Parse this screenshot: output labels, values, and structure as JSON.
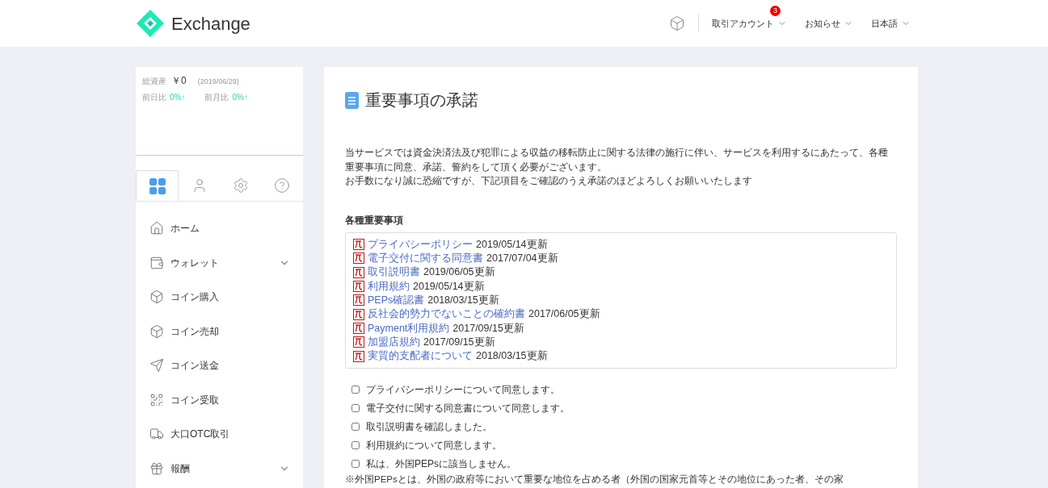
{
  "header": {
    "brand": "Exchange",
    "nav": [
      {
        "label": "取引アカウント",
        "badge": "3"
      },
      {
        "label": "お知らせ"
      },
      {
        "label": "日本語"
      }
    ]
  },
  "summary": {
    "total_label": "総資産",
    "total_value": "￥0",
    "date": "(2019/06/29)",
    "changes": [
      {
        "label": "前日比",
        "value": "0%↑"
      },
      {
        "label": "前月比",
        "value": "0%↑"
      }
    ]
  },
  "sidebar_tabs": [
    {
      "kind": "grid",
      "selected": true
    },
    {
      "kind": "user",
      "selected": false
    },
    {
      "kind": "settings",
      "selected": false
    },
    {
      "kind": "help",
      "selected": false
    }
  ],
  "sidebar": {
    "items": [
      {
        "kind": "home",
        "label": "ホーム",
        "expandable": false
      },
      {
        "kind": "wallet",
        "label": "ウォレット",
        "expandable": true
      },
      {
        "kind": "box",
        "label": "コイン購入",
        "expandable": false
      },
      {
        "kind": "box",
        "label": "コイン売却",
        "expandable": false
      },
      {
        "kind": "send",
        "label": "コイン送金",
        "expandable": false
      },
      {
        "kind": "qr",
        "label": "コイン受取",
        "expandable": false
      },
      {
        "kind": "truck",
        "label": "大口OTC取引",
        "expandable": false
      },
      {
        "kind": "gift",
        "label": "報酬",
        "expandable": true
      }
    ]
  },
  "page": {
    "title": "重要事項の承諾",
    "intro": [
      "当サービスでは資金決済法及び犯罪による収益の移転防止に関する法律の施行に伴い、サービスを利用するにあたって、各種重要事項に同意、承諾、誓約をして頂く必要がございます。",
      "お手数になり誠に恐縮ですが、下記項目をご確認のうえ承諾のほどよろしくお願いいたします"
    ],
    "documents_heading": "各種重要事項",
    "documents": [
      {
        "link": "プライバシーポリシー",
        "updated": "2019/05/14更新"
      },
      {
        "link": "電子交付に関する同意書",
        "updated": "2017/07/04更新"
      },
      {
        "link": "取引説明書",
        "updated": "2019/06/05更新"
      },
      {
        "link": "利用規約",
        "updated": "2019/05/14更新"
      },
      {
        "link": "PEPs確認書",
        "updated": "2018/03/15更新"
      },
      {
        "link": "反社会的勢力でないことの確約書",
        "updated": "2017/06/05更新"
      },
      {
        "link": "Payment利用規約",
        "updated": "2017/09/15更新"
      },
      {
        "link": "加盟店規約",
        "updated": "2017/09/15更新"
      },
      {
        "link": "実質的支配者について",
        "updated": "2018/03/15更新"
      }
    ],
    "agreements": [
      {
        "label": "プライバシーポリシーについて同意します。",
        "checked": false
      },
      {
        "label": "電子交付に関する同意書について同意します。",
        "checked": false
      },
      {
        "label": "取引説明書を確認しました。",
        "checked": false
      },
      {
        "label": "利用規約について同意します。",
        "checked": false
      },
      {
        "label": "私は、外国PEPsに該当しません。",
        "checked": false
      }
    ],
    "note": "※外国PEPsとは、外国の政府等において重要な地位を占める者（外国の国家元首等とその地位にあった者、その家"
  }
}
